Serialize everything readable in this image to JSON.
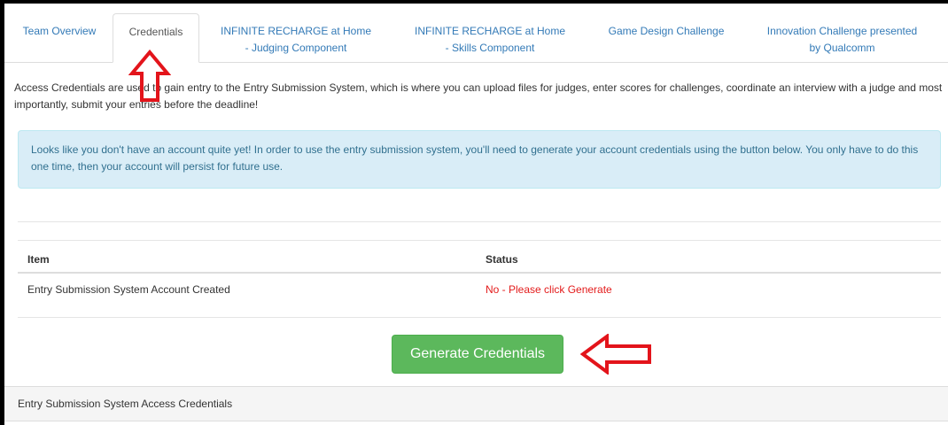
{
  "tabs": [
    {
      "line1": "Team Overview",
      "line2": ""
    },
    {
      "line1": "Credentials",
      "line2": ""
    },
    {
      "line1": "INFINITE RECHARGE at Home",
      "line2": "- Judging Component"
    },
    {
      "line1": "INFINITE RECHARGE at Home",
      "line2": "- Skills Component"
    },
    {
      "line1": "Game Design Challenge",
      "line2": ""
    },
    {
      "line1": "Innovation Challenge presented",
      "line2": "by Qualcomm"
    }
  ],
  "active_tab": "Credentials",
  "intro_text": "Access Credentials are used to gain entry to the Entry Submission System, which is where you can upload files for judges, enter scores for challenges, coordinate an interview with a judge and most importantly, submit your entries before the deadline!",
  "alert_text": "Looks like you don't have an account quite yet! In order to use the entry submission system, you'll need to generate your account credentials using the button below. You only have to do this one time, then your account will persist for future use.",
  "table": {
    "headers": [
      "Item",
      "Status"
    ],
    "rows": [
      {
        "item": "Entry Submission System Account Created",
        "status": "No - Please click Generate"
      }
    ]
  },
  "generate_button_label": "Generate Credentials",
  "footer_panel_title": "Entry Submission System Access Credentials",
  "colors": {
    "link": "#337ab7",
    "alert_bg": "#d9edf7",
    "alert_text": "#31708f",
    "success_button": "#5cb85c",
    "status_red": "#e31b1b",
    "annotation_arrow": "#e3141b"
  },
  "annotations": [
    "red-up-arrow-icon",
    "red-left-arrow-icon"
  ]
}
